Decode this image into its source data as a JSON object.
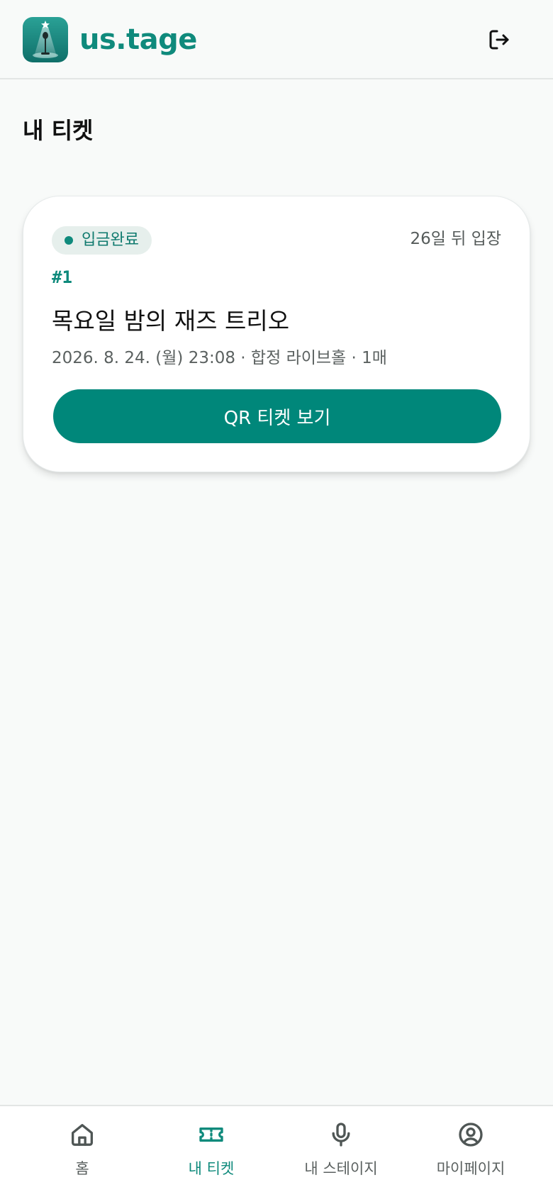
{
  "app": {
    "brand": "us.tage",
    "logo_icon": "spotlight-microphone-icon",
    "logout_icon": "logout-icon"
  },
  "page": {
    "title": "내 티켓"
  },
  "tickets": [
    {
      "status": "입금완료",
      "d_day": "26일 뒤 입장",
      "number": "#1",
      "title": "목요일 밤의 재즈 트리오",
      "meta": "2026. 8. 24. (월) 23:08 · 합정 라이브홀 · 1매",
      "button_label": "QR 티켓 보기"
    }
  ],
  "nav": {
    "items": [
      {
        "label": "홈",
        "icon": "home-icon",
        "active": false
      },
      {
        "label": "내 티켓",
        "icon": "ticket-icon",
        "active": true
      },
      {
        "label": "내 스테이지",
        "icon": "microphone-icon",
        "active": false
      },
      {
        "label": "마이페이지",
        "icon": "user-circle-icon",
        "active": false
      }
    ]
  },
  "colors": {
    "accent": "#0f8a7c",
    "button": "#00877a",
    "badge_bg": "#e6efec",
    "background": "#f8faf9"
  }
}
